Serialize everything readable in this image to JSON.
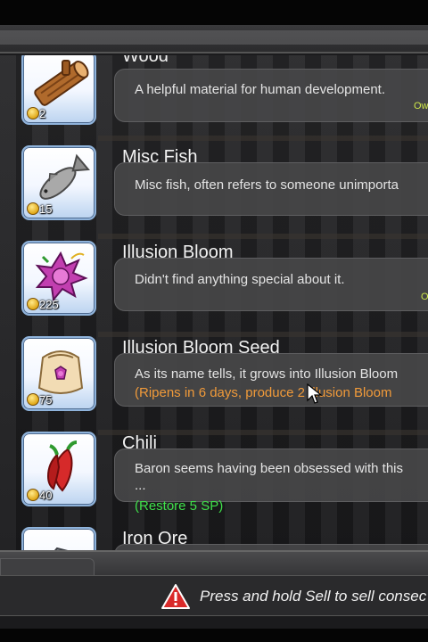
{
  "items": [
    {
      "name": "Wood",
      "icon": "wood-log-icon",
      "price": "2",
      "description": "A helpful material for human development.",
      "owned": "Ow"
    },
    {
      "name": "Misc Fish",
      "icon": "fish-icon",
      "price": "15",
      "description": "Misc fish, often refers to someone unimporta",
      "owned": ""
    },
    {
      "name": "Illusion Bloom",
      "icon": "illusion-bloom-flower-icon",
      "price": "225",
      "description": "Didn't find anything special about it.",
      "owned": "O"
    },
    {
      "name": "Illusion Bloom Seed",
      "icon": "seed-bag-icon",
      "price": "75",
      "description": "As its name tells, it grows into Illusion Bloom",
      "extra": "(Ripens in 6 days, produce 2 Illusion Bloom",
      "owned": ""
    },
    {
      "name": "Chili",
      "icon": "chili-pepper-icon",
      "price": "40",
      "description": "Baron seems having been obsessed with this",
      "description2": "...",
      "extra": "(Restore 5 SP)",
      "owned": ""
    },
    {
      "name": "Iron Ore",
      "icon": "iron-ore-icon",
      "price": "",
      "description": "",
      "owned": ""
    }
  ],
  "footer": {
    "hint": "Press and hold Sell to sell consec",
    "hint_icon": "warning-icon"
  },
  "colors": {
    "tile_border": "#8fb3db",
    "extra_orange": "#f09a3a",
    "extra_green": "#3fe04a",
    "warning_red": "#d92a2a"
  }
}
